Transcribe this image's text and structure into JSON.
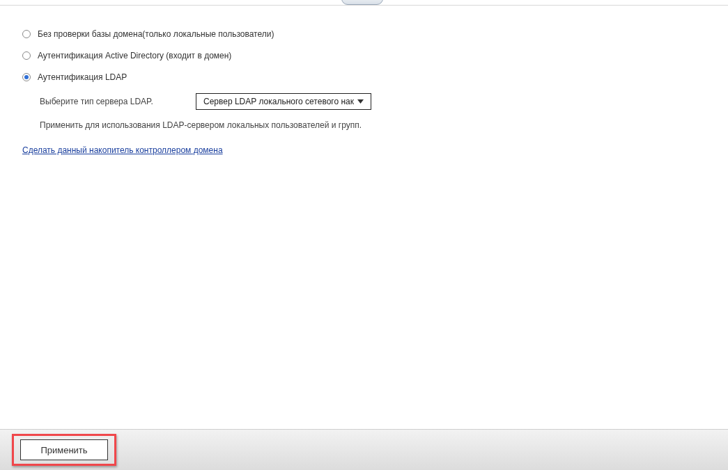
{
  "options": [
    {
      "label": "Без проверки базы домена(только локальные пользователи)",
      "selected": false
    },
    {
      "label": "Аутентификация Active Directory (входит в домен)",
      "selected": false
    },
    {
      "label": "Аутентификация LDAP",
      "selected": true
    }
  ],
  "ldap": {
    "label": "Выберите тип сервера LDAP.",
    "value": "Сервер LDAP локального сетевого нак",
    "note": "Применить для использования LDAP-сервером локальных пользователей и групп."
  },
  "link": "Сделать данный накопитель контроллером домена",
  "footer": {
    "button": "Применить",
    "highlighted": true
  }
}
